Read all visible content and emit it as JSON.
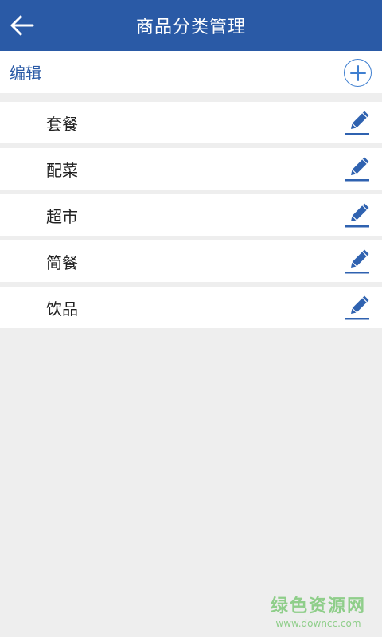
{
  "header": {
    "title": "商品分类管理",
    "back_icon": "arrow-left-icon"
  },
  "toolbar": {
    "edit_label": "编辑",
    "add_icon": "plus-circle-icon"
  },
  "categories": [
    {
      "label": "套餐"
    },
    {
      "label": "配菜"
    },
    {
      "label": "超市"
    },
    {
      "label": "简餐"
    },
    {
      "label": "饮品"
    }
  ],
  "watermark": {
    "title": "绿色资源网",
    "url": "www.downcc.com"
  },
  "colors": {
    "primary": "#2a5aa6",
    "accent": "#3f7fd0",
    "background": "#eeeeee",
    "watermark": "#8fce8a"
  }
}
